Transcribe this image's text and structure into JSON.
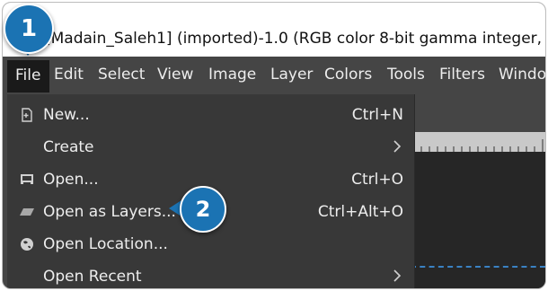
{
  "window": {
    "title": "[Madain_Saleh1] (imported)-1.0 (RGB color 8-bit gamma integer,"
  },
  "menubar": {
    "items": [
      "File",
      "Edit",
      "Select",
      "View",
      "Image",
      "Layer",
      "Colors",
      "Tools",
      "Filters",
      "Windo"
    ]
  },
  "file_menu": {
    "items": [
      {
        "label": "New...",
        "shortcut": "Ctrl+N",
        "icon": "new-document-icon"
      },
      {
        "label": "Create",
        "shortcut": "",
        "icon": "",
        "submenu": true
      },
      {
        "label": "Open...",
        "shortcut": "Ctrl+O",
        "icon": "open-image-icon"
      },
      {
        "label": "Open as Layers...",
        "shortcut": "Ctrl+Alt+O",
        "icon": "open-as-layers-icon"
      },
      {
        "label": "Open Location...",
        "shortcut": "",
        "icon": "globe-icon"
      },
      {
        "label": "Open Recent",
        "shortcut": "",
        "icon": "",
        "submenu": true
      }
    ]
  },
  "callouts": {
    "step1": "1",
    "step2": "2"
  },
  "colors": {
    "menu_bg": "#454545",
    "dropdown_bg": "#383838",
    "badge": "#1b73b3",
    "text": "#ededed"
  }
}
